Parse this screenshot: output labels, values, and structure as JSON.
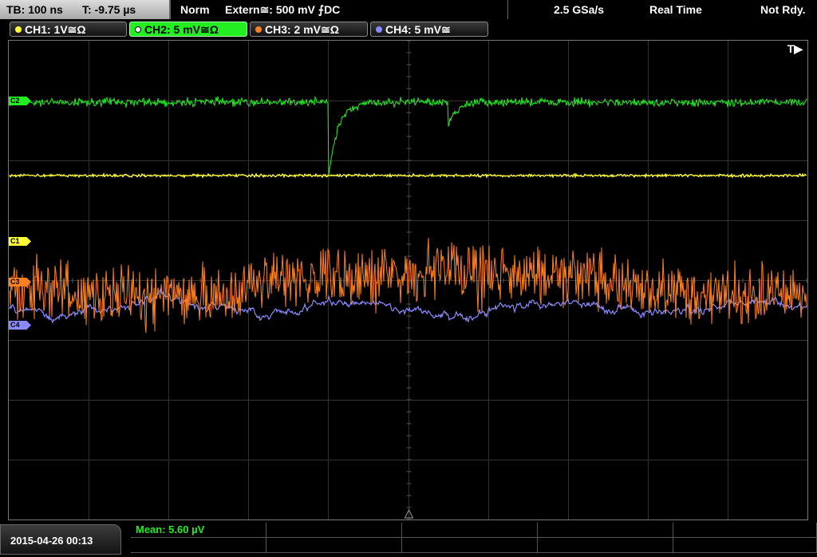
{
  "header": {
    "timebase": "TB: 100 ns",
    "trigger_time": "T: -9.75 µs",
    "trigger_mode": "Norm",
    "trigger_source": "Extern≅: 500 mV ⨍DC",
    "sample_rate": "2.5 GSa/s",
    "acq_mode": "Real Time",
    "status": "Not Rdy."
  },
  "channels": [
    {
      "label": "CH1: 1V≅Ω",
      "color": "#ffff33",
      "active": false
    },
    {
      "label": "CH2: 5 mV≅Ω",
      "color": "#22ee22",
      "active": true
    },
    {
      "label": "CH3: 2 mV≅Ω",
      "color": "#ff8020",
      "active": false
    },
    {
      "label": "CH4: 5 mV≅",
      "color": "#8a8aff",
      "active": false
    }
  ],
  "markers": {
    "c1": "C1",
    "c2": "C2",
    "c3": "C3",
    "c4": "C4"
  },
  "trigger_marker": "T▶",
  "footer": {
    "datetime": "2015-04-26 00:13",
    "measurement": "Mean: 5.60 µV"
  },
  "colors": {
    "ch1": "#ffff33",
    "ch2": "#22ee22",
    "ch3": "#ff8020",
    "ch4": "#8a8aff",
    "grid": "#333333"
  }
}
